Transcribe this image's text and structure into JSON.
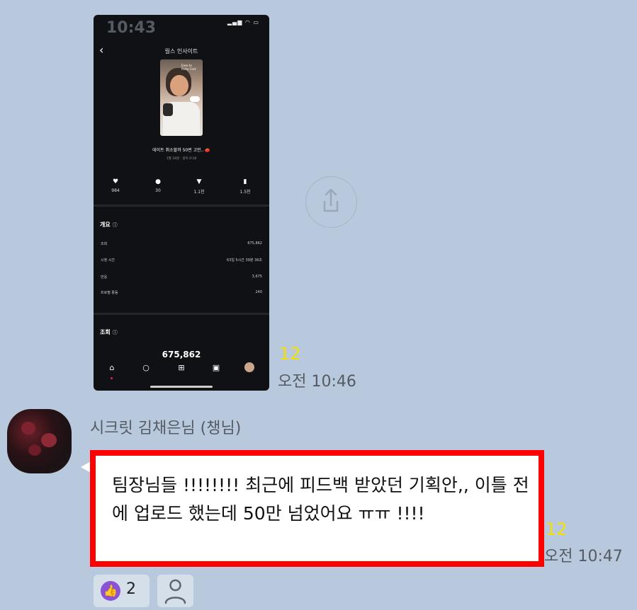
{
  "phone": {
    "status_time": "10:43",
    "status_icons": "▂▄▆ ◠ ▭",
    "title": "릴스 인사이트",
    "caption": "데이트 취소할까 50번 고민.. 🍅",
    "subcaption": "1월 18일 · 길이 0:18",
    "stats": [
      {
        "icon": "heart-icon",
        "value": "984"
      },
      {
        "icon": "comment-icon",
        "value": "30"
      },
      {
        "icon": "send-icon",
        "value": "1.1천"
      },
      {
        "icon": "bookmark-icon",
        "value": "1.5천"
      }
    ],
    "overview_title": "개요",
    "overview": [
      {
        "label": "조회",
        "value": "675,862"
      },
      {
        "label": "시청 시간",
        "value": "63일 5시간 39분 36초"
      },
      {
        "label": "반응",
        "value": "3,675"
      },
      {
        "label": "프로필 활동",
        "value": "240"
      }
    ],
    "views_title": "조회",
    "views_value": "675,862",
    "thumb_overlay": "Ease to Party Cost"
  },
  "msg1": {
    "unread": "12",
    "time": "오전 10:46"
  },
  "sender": {
    "name": "시크릿 김채은님 (챙님)"
  },
  "msg2": {
    "text": "팀장님들 !!!!!!!! 최근에 피드백 받았던 기획안,, 이틀 전에 업로드 했는데 50만 넘었어요 ㅠㅠ !!!!",
    "unread": "12",
    "time": "오전 10:47"
  },
  "reactions": {
    "like_count": "2"
  },
  "colors": {
    "background": "#b9c9dd",
    "unread": "#f4e000",
    "highlight": "#ff0000",
    "like": "#8a52d4"
  }
}
